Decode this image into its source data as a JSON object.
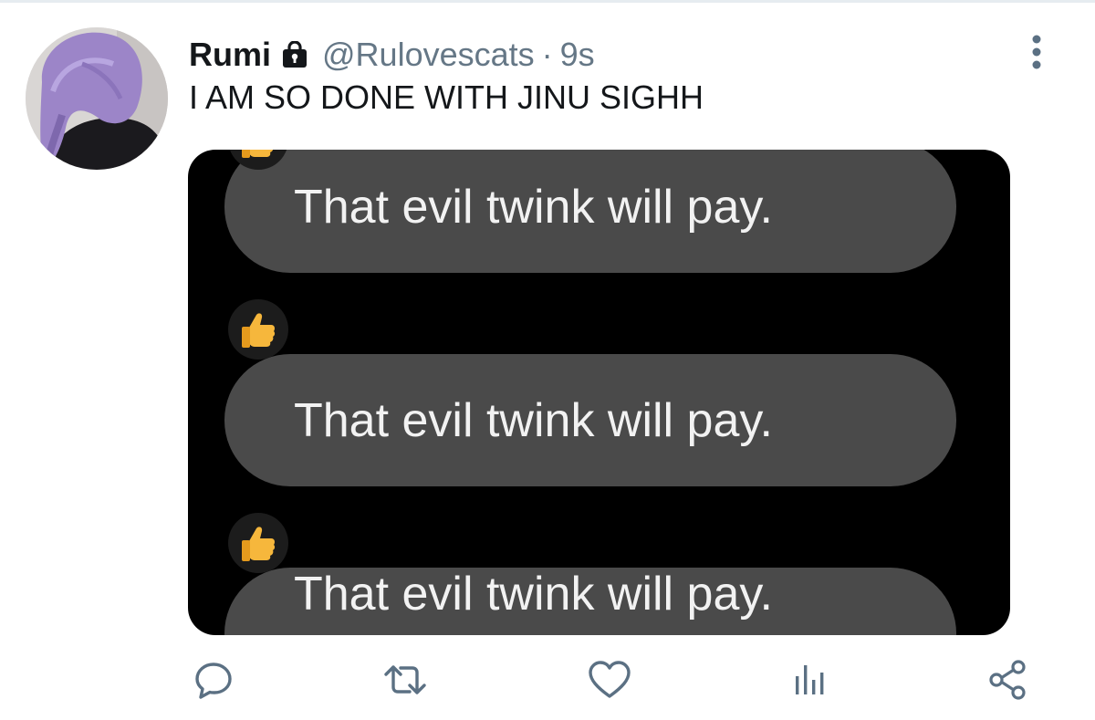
{
  "tweet": {
    "display_name": "Rumi",
    "handle": "@Rulovescats",
    "separator": "·",
    "timestamp": "9s",
    "text": "I AM SO DONE WITH JINU SIGHH",
    "protected_icon": "lock-icon",
    "more_icon": "vertical-ellipsis-icon"
  },
  "media": {
    "bubbles": [
      {
        "text": "That evil twink will pay."
      },
      {
        "text": "That evil twink will pay."
      },
      {
        "text": "That evil twink will pay."
      }
    ],
    "reaction_icon": "thumbs-up-icon"
  },
  "actions": [
    {
      "icon": "reply-icon"
    },
    {
      "icon": "retweet-icon"
    },
    {
      "icon": "like-icon"
    },
    {
      "icon": "views-icon"
    },
    {
      "icon": "share-icon"
    }
  ],
  "colors": {
    "text": "#14171a",
    "secondary": "#657786",
    "action_icon": "#5b7083",
    "bubble": "#4a4a4a",
    "media_bg": "#000000"
  }
}
